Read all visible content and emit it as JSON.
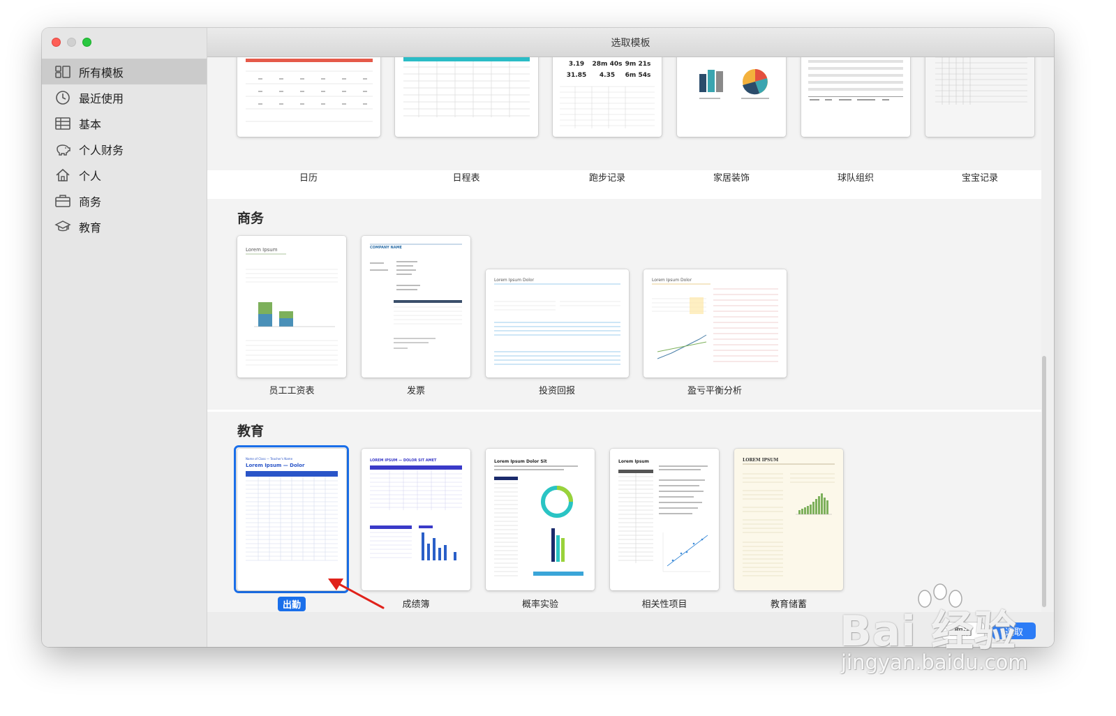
{
  "window": {
    "title": "选取模板"
  },
  "sidebar": {
    "items": [
      {
        "label": "所有模板",
        "icon": "grid-icon",
        "active": true
      },
      {
        "label": "最近使用",
        "icon": "clock-icon",
        "active": false
      },
      {
        "label": "基本",
        "icon": "table-icon",
        "active": false
      },
      {
        "label": "个人财务",
        "icon": "piggy-bank-icon",
        "active": false
      },
      {
        "label": "个人",
        "icon": "house-icon",
        "active": false
      },
      {
        "label": "商务",
        "icon": "briefcase-icon",
        "active": false
      },
      {
        "label": "教育",
        "icon": "graduation-cap-icon",
        "active": false
      }
    ]
  },
  "sections": {
    "personal": {
      "templates": [
        {
          "label": "日历"
        },
        {
          "label": "日程表"
        },
        {
          "label": "跑步记录"
        },
        {
          "label": "家居装饰"
        },
        {
          "label": "球队组织"
        },
        {
          "label": "宝宝记录"
        }
      ],
      "running_stats": [
        "3.19",
        "28m 40s",
        "9m 21s",
        "31.85",
        "4.35",
        "6m 54s"
      ]
    },
    "business": {
      "title": "商务",
      "templates": [
        {
          "label": "员工工资表",
          "heading": "Lorem Ipsum"
        },
        {
          "label": "发票",
          "heading": "COMPANY NAME"
        },
        {
          "label": "投资回报",
          "heading": "Lorem Ipsum Dolor"
        },
        {
          "label": "盈亏平衡分析",
          "heading": "Lorem Ipsum Dolor"
        }
      ]
    },
    "education": {
      "title": "教育",
      "templates": [
        {
          "label": "出勤",
          "heading": "Lorem Ipsum — Dolor",
          "selected": true
        },
        {
          "label": "成绩簿",
          "heading": "LOREM IPSUM — DOLOR SIT AMET"
        },
        {
          "label": "概率实验",
          "heading": "Lorem Ipsum Dolor Sit"
        },
        {
          "label": "相关性项目",
          "heading": "Lorem Ipsum"
        },
        {
          "label": "教育储蓄",
          "heading": "LOREM IPSUM"
        }
      ]
    }
  },
  "footer": {
    "cancel_label": "取消",
    "choose_label": "选取"
  },
  "watermark": {
    "logo": "Bai 经验",
    "url": "jingyan.baidu.com"
  },
  "colors": {
    "accent": "#1a6fea",
    "sidebar_bg": "#e6e6e6",
    "close": "#fe5f57",
    "maximize": "#29c740"
  }
}
